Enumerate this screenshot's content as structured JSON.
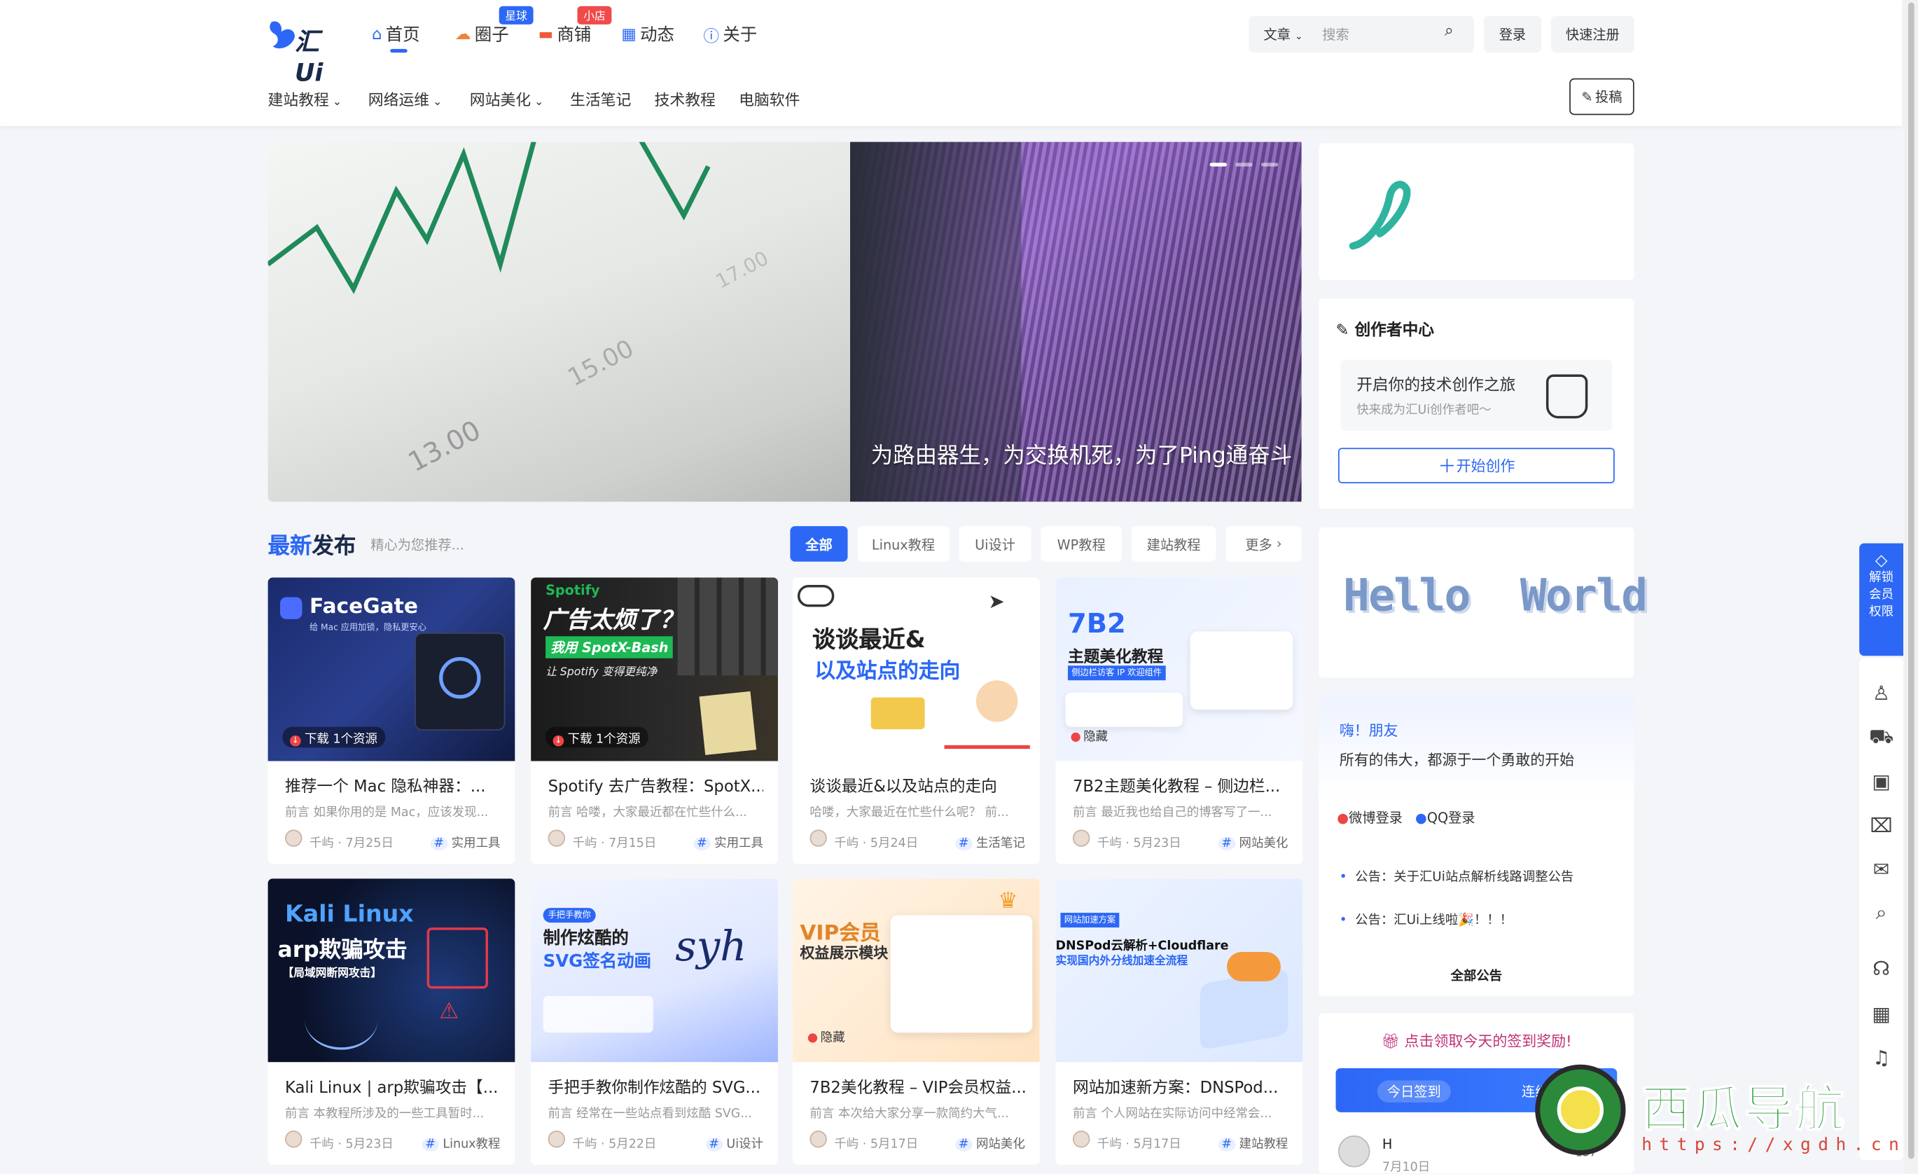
{
  "header": {
    "logo_text": "汇Ui",
    "nav": [
      {
        "label": "首页",
        "icon": "home-icon"
      },
      {
        "label": "圈子",
        "icon": "circle-icon",
        "badge": "星球"
      },
      {
        "label": "商铺",
        "icon": "shop-icon",
        "badge": "小店"
      },
      {
        "label": "动态",
        "icon": "dynamic-icon"
      },
      {
        "label": "关于",
        "icon": "info-icon"
      }
    ],
    "search_type": "文章",
    "search_placeholder": "搜索",
    "login": "登录",
    "register": "快速注册",
    "subnav": [
      "建站教程",
      "网络运维",
      "网站美化",
      "生活笔记",
      "技术教程",
      "电脑软件"
    ],
    "post_button": "投稿"
  },
  "slider": {
    "title": "为路由器生，为交换机死，为了Ping通奋斗"
  },
  "latest": {
    "title_blue": "最新",
    "title_dark": "发布",
    "subtitle": "精心为您推荐...",
    "tabs": [
      "全部",
      "Linux教程",
      "Ui设计",
      "WP教程",
      "建站教程",
      "更多"
    ]
  },
  "posts": [
    {
      "title": "推荐一个 Mac 隐私神器：...",
      "desc": "前言 如果你用的是 Mac，应该发现...",
      "author": "千屿",
      "date": "7月25日",
      "tag": "实用工具",
      "download": "下载",
      "resource": "1个资源",
      "thumb_title": "FaceGate",
      "thumb_sub": "给 Mac 应用加锁，隐私更安心"
    },
    {
      "title": "Spotify 去广告教程：SpotX...",
      "desc": "前言 哈喽，大家最近都在忙些什么...",
      "author": "千屿",
      "date": "7月15日",
      "tag": "实用工具",
      "download": "下载",
      "resource": "1个资源",
      "thumb_title": "广告太烦了？",
      "thumb_sub": "我用 SpotX-Bash",
      "thumb_sub2": "让 Spotify 变得更纯净",
      "thumb_brand": "Spotify"
    },
    {
      "title": "谈谈最近&以及站点的走向",
      "desc": "哈喽，大家最近在忙些什么呢？ 前...",
      "author": "千屿",
      "date": "5月24日",
      "tag": "生活笔记",
      "thumb_title": "谈谈最近&",
      "thumb_sub": "以及站点的走向"
    },
    {
      "title": "7B2主题美化教程 – 侧边栏...",
      "desc": "前言 最近我也给自己的博客写了一...",
      "author": "千屿",
      "date": "5月23日",
      "tag": "网站美化",
      "hidden": "隐藏",
      "thumb_title": "7B2",
      "thumb_sub": "主题美化教程",
      "thumb_sub2": "侧边栏访客 IP 欢迎组件"
    },
    {
      "title": "Kali Linux | arp欺骗攻击【...",
      "desc": "前言 本教程所涉及的一些工具暂时...",
      "author": "千屿",
      "date": "5月23日",
      "tag": "Linux教程",
      "thumb_title": "Kali Linux",
      "thumb_sub": "arp欺骗攻击",
      "thumb_sub2": "【局域网断网攻击】"
    },
    {
      "title": "手把手教你制作炫酷的 SVG...",
      "desc": "前言 经常在一些站点看到炫酷 SVG...",
      "author": "千屿",
      "date": "5月22日",
      "tag": "Ui设计",
      "thumb_badge": "手把手教你",
      "thumb_title": "制作炫酷的",
      "thumb_sub": "SVG签名动画",
      "thumb_sig": "syh"
    },
    {
      "title": "7B2美化教程 – VIP会员权益...",
      "desc": "前言 本次给大家分享一款简约大气...",
      "author": "千屿",
      "date": "5月17日",
      "tag": "网站美化",
      "hidden": "隐藏",
      "thumb_title": "VIP会员",
      "thumb_sub": "权益展示模块"
    },
    {
      "title": "网站加速新方案：DNSPod...",
      "desc": "前言 个人网站在实际访问中经常会...",
      "author": "千屿",
      "date": "5月17日",
      "tag": "建站教程",
      "thumb_badge": "网站加速方案",
      "thumb_title": "DNSPod云解析+Cloudflare",
      "thumb_sub": "实现国内外分线加速全流程"
    }
  ],
  "sidebar": {
    "creator_title": "创作者中心",
    "creator_heading": "开启你的技术创作之旅",
    "creator_sub": "快来成为汇Ui创作者吧～",
    "creator_button": "开始创作",
    "hello": "Hello  World",
    "greeting": "嗨！朋友",
    "motto": "所有的伟大，都源于一个勇敢的开始",
    "weibo_login": "微博登录",
    "qq_login": "QQ登录",
    "notices": [
      "公告：关于汇Ui站点解析线路调整公告",
      "公告：汇Ui上线啦🎉！！！"
    ],
    "all_notices": "全部公告",
    "checkin_tip": "点击领取今天的签到奖励!",
    "checkin_today": "今日签到",
    "checkin_streak": "连续签到",
    "user_name": "H",
    "user_date": "7月10日",
    "user_count": "157"
  },
  "right_bar": {
    "unlock": [
      "解锁",
      "会员",
      "权限"
    ]
  },
  "watermark": {
    "title": "西瓜导航",
    "url": "https://xgdh.cn"
  },
  "colors": {
    "accent": "#2c68f5",
    "text": "#333333",
    "bg": "#f3f5f8"
  }
}
